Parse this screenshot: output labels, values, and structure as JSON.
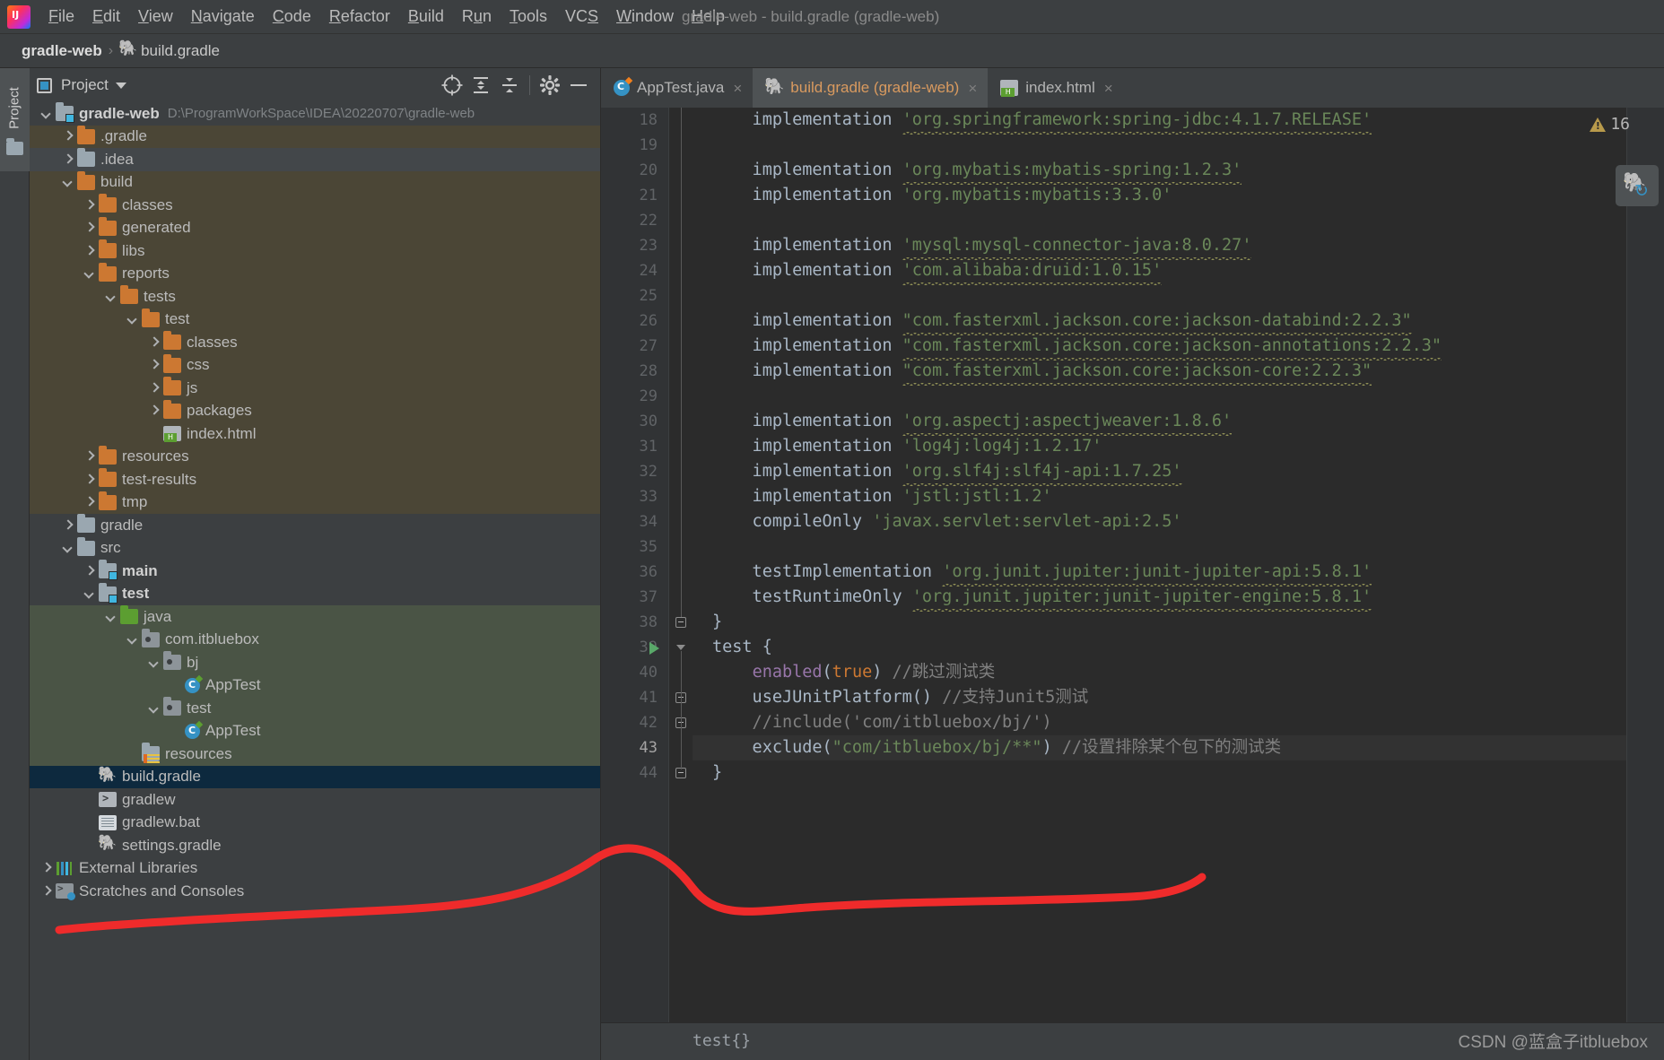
{
  "window": {
    "title": "gradle-web - build.gradle (gradle-web)",
    "app_logo": "intellij-idea-logo"
  },
  "menubar": {
    "items": [
      {
        "label": "File",
        "mnemonic": "F"
      },
      {
        "label": "Edit",
        "mnemonic": "E"
      },
      {
        "label": "View",
        "mnemonic": "V"
      },
      {
        "label": "Navigate",
        "mnemonic": "N"
      },
      {
        "label": "Code",
        "mnemonic": "C"
      },
      {
        "label": "Refactor",
        "mnemonic": "R"
      },
      {
        "label": "Build",
        "mnemonic": "B"
      },
      {
        "label": "Run",
        "mnemonic": "u"
      },
      {
        "label": "Tools",
        "mnemonic": "T"
      },
      {
        "label": "VCS",
        "mnemonic": "S"
      },
      {
        "label": "Window",
        "mnemonic": "W"
      },
      {
        "label": "Help",
        "mnemonic": "H"
      }
    ]
  },
  "navbar": {
    "crumbs": [
      "gradle-web",
      "build.gradle"
    ],
    "separator": "›"
  },
  "toolstrip": {
    "project_tab": "Project"
  },
  "project_panel": {
    "title": "Project",
    "toolbar": [
      {
        "name": "locate-icon",
        "glyph": "⊕"
      },
      {
        "name": "expand-all-icon",
        "glyph": "↧"
      },
      {
        "name": "collapse-all-icon",
        "glyph": "↥"
      },
      {
        "name": "settings-gear-icon",
        "glyph": "⚙"
      },
      {
        "name": "hide-panel-icon",
        "glyph": "—"
      }
    ],
    "tree": [
      {
        "label": "gradle-web",
        "path": "D:\\ProgramWorkSpace\\IDEA\\20220707\\gradle-web",
        "indent": 0,
        "arrow": "down",
        "icon": "module",
        "bold": true,
        "tint": "none"
      },
      {
        "label": ".gradle",
        "indent": 1,
        "arrow": "right",
        "icon": "folder-orange",
        "tint": "excluded"
      },
      {
        "label": ".idea",
        "indent": 1,
        "arrow": "right",
        "icon": "folder-gray",
        "tint": "alt"
      },
      {
        "label": "build",
        "indent": 1,
        "arrow": "down",
        "icon": "folder-orange",
        "tint": "excluded"
      },
      {
        "label": "classes",
        "indent": 2,
        "arrow": "right",
        "icon": "folder-orange",
        "tint": "excluded"
      },
      {
        "label": "generated",
        "indent": 2,
        "arrow": "right",
        "icon": "folder-orange",
        "tint": "excluded"
      },
      {
        "label": "libs",
        "indent": 2,
        "arrow": "right",
        "icon": "folder-orange",
        "tint": "excluded"
      },
      {
        "label": "reports",
        "indent": 2,
        "arrow": "down",
        "icon": "folder-orange",
        "tint": "excluded"
      },
      {
        "label": "tests",
        "indent": 3,
        "arrow": "down",
        "icon": "folder-orange",
        "tint": "excluded"
      },
      {
        "label": "test",
        "indent": 4,
        "arrow": "down",
        "icon": "folder-orange",
        "tint": "excluded"
      },
      {
        "label": "classes",
        "indent": 5,
        "arrow": "right",
        "icon": "folder-orange",
        "tint": "excluded"
      },
      {
        "label": "css",
        "indent": 5,
        "arrow": "right",
        "icon": "folder-orange",
        "tint": "excluded"
      },
      {
        "label": "js",
        "indent": 5,
        "arrow": "right",
        "icon": "folder-orange",
        "tint": "excluded"
      },
      {
        "label": "packages",
        "indent": 5,
        "arrow": "right",
        "icon": "folder-orange",
        "tint": "excluded"
      },
      {
        "label": "index.html",
        "indent": 5,
        "arrow": "none",
        "icon": "html-file",
        "tint": "excluded"
      },
      {
        "label": "resources",
        "indent": 2,
        "arrow": "right",
        "icon": "folder-orange",
        "tint": "excluded"
      },
      {
        "label": "test-results",
        "indent": 2,
        "arrow": "right",
        "icon": "folder-orange",
        "tint": "excluded"
      },
      {
        "label": "tmp",
        "indent": 2,
        "arrow": "right",
        "icon": "folder-orange",
        "tint": "excluded"
      },
      {
        "label": "gradle",
        "indent": 1,
        "arrow": "right",
        "icon": "folder-gray",
        "tint": "none"
      },
      {
        "label": "src",
        "indent": 1,
        "arrow": "down",
        "icon": "folder-gray",
        "tint": "none"
      },
      {
        "label": "main",
        "indent": 2,
        "arrow": "right",
        "icon": "module",
        "bold": true,
        "tint": "none"
      },
      {
        "label": "test",
        "indent": 2,
        "arrow": "down",
        "icon": "module",
        "bold": true,
        "tint": "none"
      },
      {
        "label": "java",
        "indent": 3,
        "arrow": "down",
        "icon": "folder-green",
        "tint": "test"
      },
      {
        "label": "com.itbluebox",
        "indent": 4,
        "arrow": "down",
        "icon": "package",
        "tint": "test"
      },
      {
        "label": "bj",
        "indent": 5,
        "arrow": "down",
        "icon": "package",
        "tint": "test"
      },
      {
        "label": "AppTest",
        "indent": 6,
        "arrow": "none",
        "icon": "class-file",
        "tint": "test"
      },
      {
        "label": "test",
        "indent": 5,
        "arrow": "down",
        "icon": "package",
        "tint": "test"
      },
      {
        "label": "AppTest",
        "indent": 6,
        "arrow": "none",
        "icon": "class-file",
        "tint": "test"
      },
      {
        "label": "resources",
        "indent": 4,
        "arrow": "none",
        "icon": "test-resources",
        "tint": "test"
      },
      {
        "label": "build.gradle",
        "indent": 2,
        "arrow": "none",
        "icon": "gradle-file",
        "tint": "selected"
      },
      {
        "label": "gradlew",
        "indent": 2,
        "arrow": "none",
        "icon": "sh-file",
        "tint": "none"
      },
      {
        "label": "gradlew.bat",
        "indent": 2,
        "arrow": "none",
        "icon": "bat-file",
        "tint": "none"
      },
      {
        "label": "settings.gradle",
        "indent": 2,
        "arrow": "none",
        "icon": "gradle-file",
        "tint": "none"
      },
      {
        "label": "External Libraries",
        "indent": 0,
        "arrow": "right",
        "icon": "libraries",
        "tint": "none"
      },
      {
        "label": "Scratches and Consoles",
        "indent": 0,
        "arrow": "right",
        "icon": "scratches",
        "tint": "none"
      }
    ]
  },
  "editor": {
    "tabs": [
      {
        "label": "AppTest.java",
        "icon": "java-class-icon",
        "active": false,
        "close": "×"
      },
      {
        "label": "build.gradle (gradle-web)",
        "icon": "gradle-icon",
        "active": true,
        "close": "×"
      },
      {
        "label": "index.html",
        "icon": "html-icon",
        "active": false,
        "close": "×"
      }
    ],
    "first_line_number": 18,
    "current_line": 43,
    "lines": [
      {
        "n": 18,
        "tokens": [
          {
            "t": "    implementation ",
            "c": "pl"
          },
          {
            "t": "'org.springframework:spring-jdbc:4.1.7.RELEASE'",
            "c": "str-u"
          }
        ]
      },
      {
        "n": 19,
        "tokens": []
      },
      {
        "n": 20,
        "tokens": [
          {
            "t": "    implementation ",
            "c": "pl"
          },
          {
            "t": "'org.mybatis:mybatis-spring:1.2.3'",
            "c": "str-u"
          }
        ]
      },
      {
        "n": 21,
        "tokens": [
          {
            "t": "    implementation ",
            "c": "pl"
          },
          {
            "t": "'org.mybatis:mybatis:3.3.0'",
            "c": "str"
          }
        ]
      },
      {
        "n": 22,
        "tokens": []
      },
      {
        "n": 23,
        "tokens": [
          {
            "t": "    implementation ",
            "c": "pl"
          },
          {
            "t": "'mysql:mysql-connector-java:8.0.27'",
            "c": "str-u"
          }
        ]
      },
      {
        "n": 24,
        "tokens": [
          {
            "t": "    implementation ",
            "c": "pl"
          },
          {
            "t": "'com.alibaba:druid:1.0.15'",
            "c": "str-u"
          }
        ]
      },
      {
        "n": 25,
        "tokens": []
      },
      {
        "n": 26,
        "tokens": [
          {
            "t": "    implementation ",
            "c": "pl"
          },
          {
            "t": "\"com.fasterxml.jackson.core:jackson-databind:2.2.3\"",
            "c": "str-u"
          }
        ]
      },
      {
        "n": 27,
        "tokens": [
          {
            "t": "    implementation ",
            "c": "pl"
          },
          {
            "t": "\"com.fasterxml.jackson.core:jackson-annotations:2.2.3\"",
            "c": "str-u"
          }
        ]
      },
      {
        "n": 28,
        "tokens": [
          {
            "t": "    implementation ",
            "c": "pl"
          },
          {
            "t": "\"com.fasterxml.jackson.core:jackson-core:2.2.3\"",
            "c": "str-u"
          }
        ]
      },
      {
        "n": 29,
        "tokens": []
      },
      {
        "n": 30,
        "tokens": [
          {
            "t": "    implementation ",
            "c": "pl"
          },
          {
            "t": "'org.aspectj:aspectjweaver:1.8.6'",
            "c": "str-u"
          }
        ]
      },
      {
        "n": 31,
        "tokens": [
          {
            "t": "    implementation ",
            "c": "pl"
          },
          {
            "t": "'log4j:log4j:1.2.17'",
            "c": "str"
          }
        ]
      },
      {
        "n": 32,
        "tokens": [
          {
            "t": "    implementation ",
            "c": "pl"
          },
          {
            "t": "'org.slf4j:slf4j-api:1.7.25'",
            "c": "str-u"
          }
        ]
      },
      {
        "n": 33,
        "tokens": [
          {
            "t": "    implementation ",
            "c": "pl"
          },
          {
            "t": "'jstl:jstl:1.2'",
            "c": "str"
          }
        ]
      },
      {
        "n": 34,
        "tokens": [
          {
            "t": "    compileOnly ",
            "c": "pl"
          },
          {
            "t": "'javax.servlet:servlet-api:2.5'",
            "c": "str"
          }
        ]
      },
      {
        "n": 35,
        "tokens": []
      },
      {
        "n": 36,
        "tokens": [
          {
            "t": "    testImplementation ",
            "c": "pl"
          },
          {
            "t": "'org.junit.jupiter:junit-jupiter-api:5.8.1'",
            "c": "str-u"
          }
        ]
      },
      {
        "n": 37,
        "tokens": [
          {
            "t": "    testRuntimeOnly ",
            "c": "pl"
          },
          {
            "t": "'org.junit.jupiter:junit-jupiter-engine:5.8.1'",
            "c": "str-u"
          }
        ]
      },
      {
        "n": 38,
        "tokens": [
          {
            "t": "}",
            "c": "pl"
          }
        ]
      },
      {
        "n": 39,
        "tokens": [
          {
            "t": "test {",
            "c": "pl"
          }
        ]
      },
      {
        "n": 40,
        "tokens": [
          {
            "t": "    ",
            "c": "pl"
          },
          {
            "t": "enabled",
            "c": "fn"
          },
          {
            "t": "(",
            "c": "pl"
          },
          {
            "t": "true",
            "c": "kw"
          },
          {
            "t": ") ",
            "c": "pl"
          },
          {
            "t": "//跳过测试类",
            "c": "cm"
          }
        ]
      },
      {
        "n": 41,
        "tokens": [
          {
            "t": "    useJUnitPlatform() ",
            "c": "pl"
          },
          {
            "t": "//支持Junit5测试",
            "c": "cm"
          }
        ]
      },
      {
        "n": 42,
        "tokens": [
          {
            "t": "    //include('com/itbluebox/bj/')",
            "c": "cm"
          }
        ]
      },
      {
        "n": 43,
        "tokens": [
          {
            "t": "    exclude(",
            "c": "pl"
          },
          {
            "t": "\"com/itbluebox/bj/**\"",
            "c": "str"
          },
          {
            "t": ") ",
            "c": "pl"
          },
          {
            "t": "//设置排除某个包下的测试类",
            "c": "cm"
          }
        ]
      },
      {
        "n": 44,
        "tokens": [
          {
            "t": "}",
            "c": "pl"
          }
        ]
      }
    ],
    "warning_badge": {
      "icon": "warning-triangle-icon",
      "count": "16"
    },
    "gradle_refresh_button": {
      "name": "reload-gradle-project-button",
      "elephant": "🐘",
      "refresh": "↻"
    },
    "status_breadcrumb": "test{}"
  },
  "watermark": "CSDN @蓝盒子itbluebox",
  "colors": {
    "accent_blue": "#3592c4",
    "folder_orange": "#cc7832",
    "string_green": "#6a8759",
    "comment_gray": "#808080",
    "selection_navy": "#0d293e",
    "test_root_green": "#4a5445",
    "excluded_tint": "#4b4636",
    "annotation_red": "#ef2b2b"
  }
}
